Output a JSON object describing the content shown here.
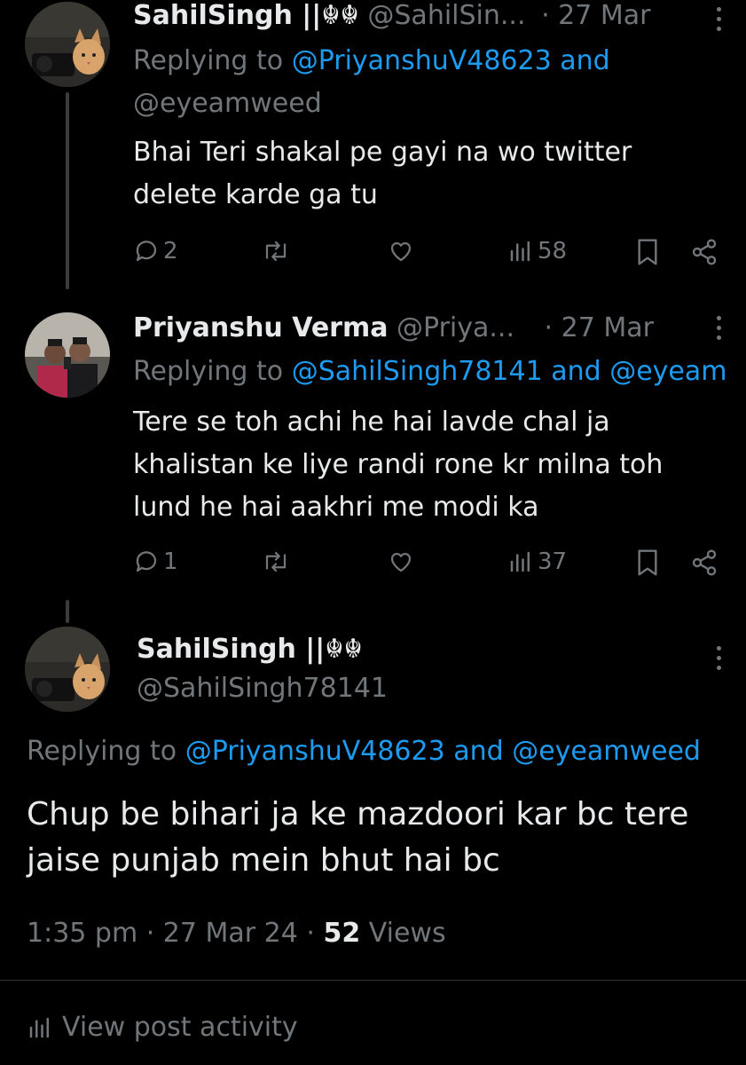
{
  "tweet1": {
    "name": "SahilSingh ||☬☬",
    "handle": "@SahilSin...",
    "date": "· 27 Mar",
    "replying_prefix": "Replying to",
    "replying_users": "@PriyanshuV48623 and",
    "replying_users2": "@eyeamweed",
    "text_line1": "Bhai Teri shakal pe gayi na wo twitter",
    "text_line2": "delete karde ga tu",
    "replies": "2",
    "views": "58"
  },
  "tweet2": {
    "name": "Priyanshu Verma",
    "handle": "@Priya...",
    "date": "· 27 Mar",
    "replying_prefix": "Replying to",
    "replying_users": "@SahilSingh78141 and @eyeam",
    "text_line1": "Tere se toh achi he hai lavde chal ja",
    "text_line2": "khalistan ke liye randi rone kr milna toh",
    "text_line3": "lund he hai aakhri me modi ka",
    "replies": "1",
    "views": "37"
  },
  "main": {
    "name": "SahilSingh ||☬☬",
    "handle": "@SahilSingh78141",
    "replying_prefix": "Replying to",
    "replying_users": "@PriyanshuV48623 and @eyeamweed",
    "text_line1": "Chup be bihari ja ke mazdoori kar bc tere",
    "text_line2": "jaise punjab mein bhut hai bc",
    "time": "1:35 pm",
    "date": "27 Mar 24",
    "views_count": "52",
    "views_label": "Views",
    "activity_label": "View post activity"
  },
  "colors": {
    "accent": "#1d9bf0",
    "muted": "#71767b",
    "text": "#e7e9ea",
    "bg": "#000000"
  }
}
